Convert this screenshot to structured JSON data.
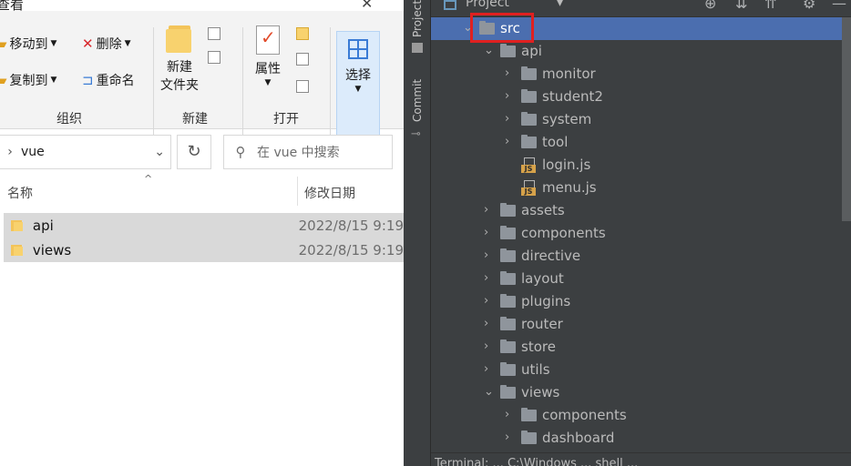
{
  "explorer": {
    "window_title": "查看",
    "ribbon": {
      "organize": {
        "move_to": "移动到",
        "delete": "删除",
        "copy_to": "复制到",
        "rename": "重命名",
        "group_label": "组织"
      },
      "new": {
        "new_folder_line1": "新建",
        "new_folder_line2": "文件夹",
        "group_label": "新建"
      },
      "open": {
        "properties": "属性",
        "group_label": "打开"
      },
      "select": {
        "label": "选择"
      }
    },
    "address": {
      "path": "vue"
    },
    "search": {
      "placeholder": "在 vue 中搜索"
    },
    "columns": {
      "name": "名称",
      "modified": "修改日期"
    },
    "files": [
      {
        "name": "api",
        "modified": "2022/8/15 9:19"
      },
      {
        "name": "views",
        "modified": "2022/8/15 9:19"
      }
    ]
  },
  "ide": {
    "side_tabs": {
      "project": "Project",
      "commit": "Commit"
    },
    "panel_title": "Project",
    "tree": [
      {
        "label": "src",
        "type": "folder",
        "state": "expanded",
        "selected": true
      },
      {
        "label": "api",
        "type": "folder",
        "state": "expanded"
      },
      {
        "label": "monitor",
        "type": "folder",
        "state": "collapsed"
      },
      {
        "label": "student2",
        "type": "folder",
        "state": "collapsed"
      },
      {
        "label": "system",
        "type": "folder",
        "state": "collapsed"
      },
      {
        "label": "tool",
        "type": "folder",
        "state": "collapsed"
      },
      {
        "label": "login.js",
        "type": "js"
      },
      {
        "label": "menu.js",
        "type": "js"
      },
      {
        "label": "assets",
        "type": "folder",
        "state": "collapsed"
      },
      {
        "label": "components",
        "type": "folder",
        "state": "collapsed"
      },
      {
        "label": "directive",
        "type": "folder",
        "state": "collapsed"
      },
      {
        "label": "layout",
        "type": "folder",
        "state": "collapsed"
      },
      {
        "label": "plugins",
        "type": "folder",
        "state": "collapsed"
      },
      {
        "label": "router",
        "type": "folder",
        "state": "collapsed"
      },
      {
        "label": "store",
        "type": "folder",
        "state": "collapsed"
      },
      {
        "label": "utils",
        "type": "folder",
        "state": "collapsed"
      },
      {
        "label": "views",
        "type": "folder",
        "state": "expanded"
      },
      {
        "label": "components",
        "type": "folder",
        "state": "collapsed"
      },
      {
        "label": "dashboard",
        "type": "folder",
        "state": "collapsed"
      }
    ],
    "bottom_bar": "Terminal: ... C:\\Windows ... shell ..."
  },
  "colors": {
    "ide_background": "#3c3f41",
    "selection": "#4b6eaf",
    "highlight_box": "#e02020",
    "js_badge": "#d6a24a"
  }
}
